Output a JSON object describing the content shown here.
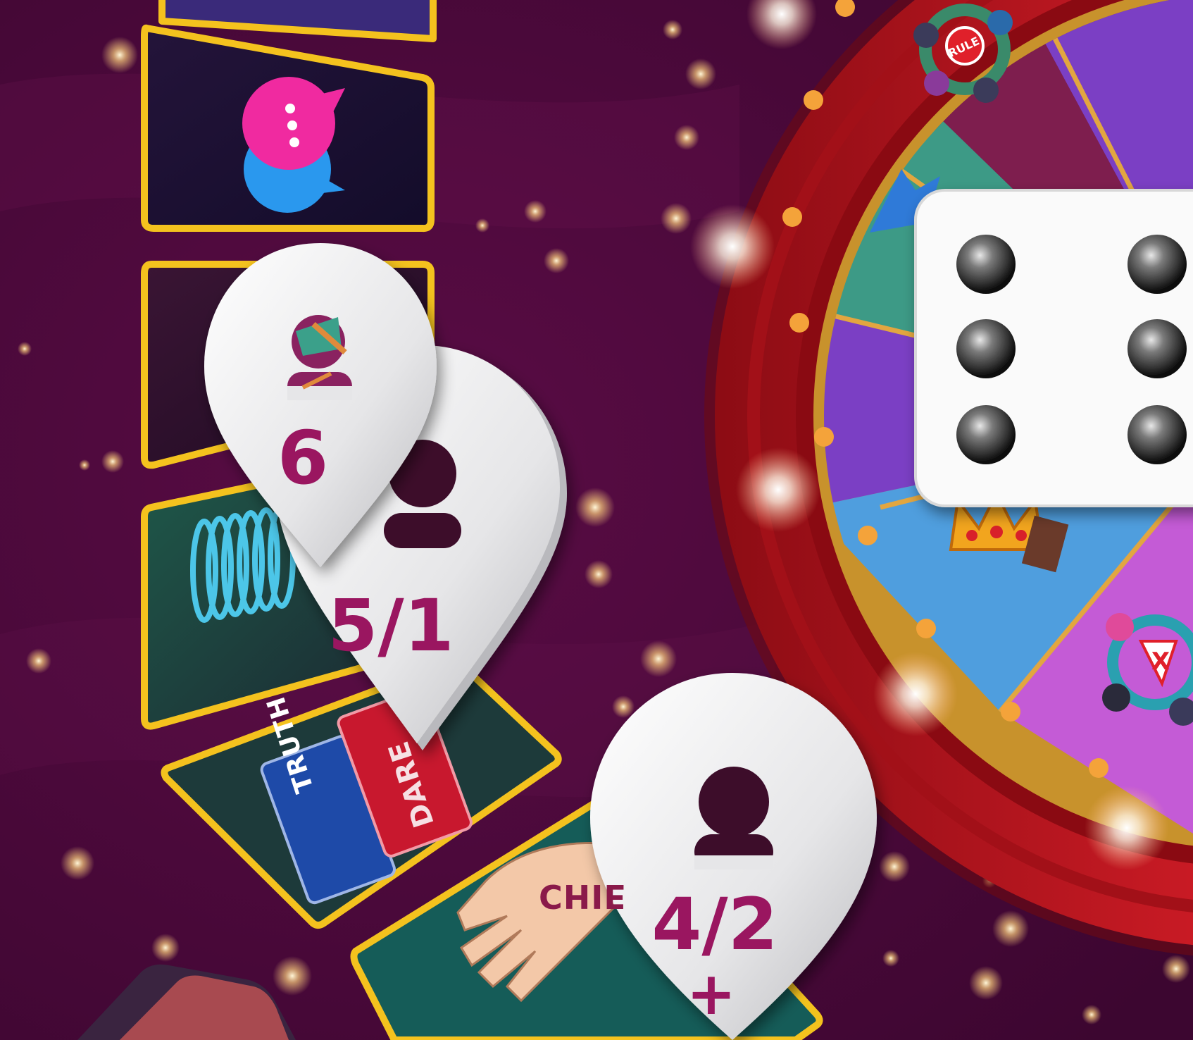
{
  "colors": {
    "background": "#4a0a3a",
    "card_border": "#f4c21e",
    "wheel_rim": "#b9141e",
    "pin_text": "#9a1660"
  },
  "cards": [
    {
      "name": "card-top-partial",
      "icon": "card-art"
    },
    {
      "name": "card-chat",
      "icon": "chat-bubbles-icon"
    },
    {
      "name": "card-dark",
      "icon": "card-art"
    },
    {
      "name": "card-spring",
      "icon": "spring-coil-icon"
    },
    {
      "name": "card-truth-dare",
      "icon": "truth-dare-cards-icon",
      "labels": {
        "truth": "TRUTH",
        "dare": "DARE"
      }
    },
    {
      "name": "card-hand",
      "icon": "hand-icon",
      "label": "CHIE"
    }
  ],
  "pins": {
    "pin_1": {
      "label": "6"
    },
    "pin_2": {
      "label": "5/1"
    },
    "pin_3": {
      "label": "4/2",
      "sublabel": "+"
    }
  },
  "wheel": {
    "segments": [
      {
        "color": "#7e1e4e",
        "icon": "people-circle-icon",
        "badge": "RULE"
      },
      {
        "color": "#3d9a86",
        "icon": "arrow-icon"
      },
      {
        "color": "#7b3fc4",
        "icon": "card-icon"
      },
      {
        "color": "#4f9ede",
        "icon": "crown-icon"
      },
      {
        "color": "#c45bd6",
        "icon": "people-circle-icon",
        "badge": "X"
      }
    ]
  },
  "dice": {
    "value": 6
  }
}
